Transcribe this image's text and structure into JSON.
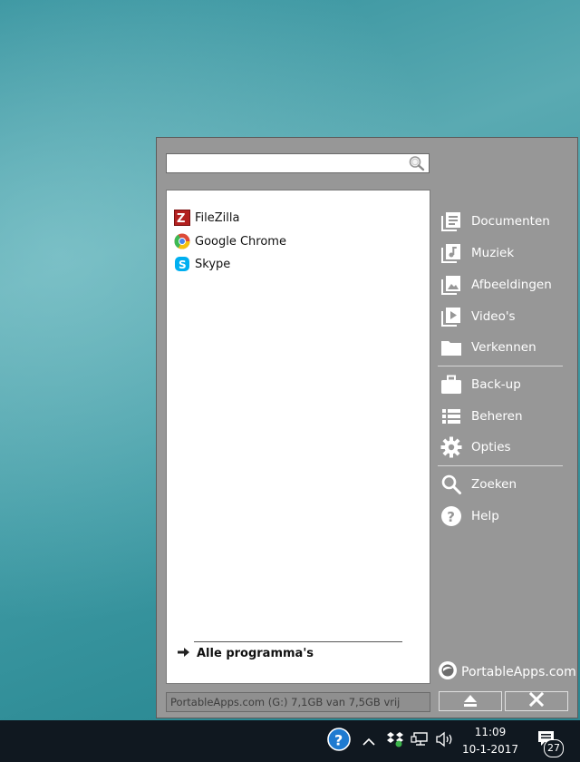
{
  "search": {
    "value": "",
    "placeholder": ""
  },
  "apps": [
    {
      "label": "FileZilla",
      "icon": "filezilla-icon"
    },
    {
      "label": "Google Chrome",
      "icon": "chrome-icon"
    },
    {
      "label": "Skype",
      "icon": "skype-icon"
    }
  ],
  "all_programs_label": "Alle programma's",
  "side_menu": [
    {
      "label": "Documenten",
      "icon": "documents-icon"
    },
    {
      "label": "Muziek",
      "icon": "music-icon"
    },
    {
      "label": "Afbeeldingen",
      "icon": "pictures-icon"
    },
    {
      "label": "Video's",
      "icon": "videos-icon"
    },
    {
      "label": "Verkennen",
      "icon": "folder-icon"
    },
    {
      "label": "Back-up",
      "icon": "briefcase-icon"
    },
    {
      "label": "Beheren",
      "icon": "list-icon"
    },
    {
      "label": "Opties",
      "icon": "gear-icon"
    },
    {
      "label": "Zoeken",
      "icon": "search-icon"
    },
    {
      "label": "Help",
      "icon": "help-icon"
    }
  ],
  "brand": "PortableApps.com",
  "status": "PortableApps.com (G:) 7,1GB van 7,5GB vrij",
  "taskbar": {
    "time": "11:09",
    "date": "10-1-2017",
    "notification_count": "27"
  },
  "colors": {
    "menu_bg": "#979797",
    "taskbar_bg": "#101820",
    "accent_blue": "#1e7ad0"
  }
}
